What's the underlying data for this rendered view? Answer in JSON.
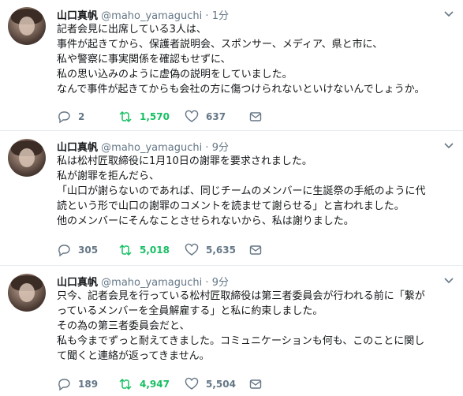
{
  "tweets": [
    {
      "name": "山口真帆",
      "handle": "@maho_yamaguchi",
      "time": "1分",
      "lines": [
        "記者会見に出席している3人は、",
        "事件が起きてから、保護者説明会、スポンサー、メディア、県と市に、",
        "私や警察に事実関係を確認もせずに、",
        "私の思い込みのように虚偽の説明をしていました。",
        "なんで事件が起きてからも会社の方に傷つけられないといけないんでしょうか。"
      ],
      "replies": "2",
      "retweets": "1,570",
      "likes": "637"
    },
    {
      "name": "山口真帆",
      "handle": "@maho_yamaguchi",
      "time": "9分",
      "lines": [
        "私は松村匠取締役に1月10日の謝罪を要求されました。",
        "私が謝罪を拒んだら、",
        "「山口が謝らないのであれば、同じチームのメンバーに生誕祭の手紙のように代",
        "読という形で山口の謝罪のコメントを読ませて謝らせる」と言われました。",
        "他のメンバーにそんなことさせられないから、私は謝りました。"
      ],
      "replies": "305",
      "retweets": "5,018",
      "likes": "5,635"
    },
    {
      "name": "山口真帆",
      "handle": "@maho_yamaguchi",
      "time": "9分",
      "lines": [
        "只今、記者会見を行っている松村匠取締役は第三者委員会が行われる前に「繋が",
        "っているメンバーを全員解雇する」と私に約束しました。",
        "その為の第三者委員会だと、",
        "私も今までずっと耐えてきました。コミュニケーションも何も、このことに関し",
        "て聞くと連絡が返ってきません。"
      ],
      "replies": "189",
      "retweets": "4,947",
      "likes": "5,504"
    }
  ],
  "colors": {
    "retweet": "#17bf63",
    "muted": "#657786",
    "text": "#14171a"
  },
  "icons": [
    "reply-icon",
    "retweet-icon",
    "like-icon",
    "dm-icon",
    "chevron-down-icon"
  ]
}
